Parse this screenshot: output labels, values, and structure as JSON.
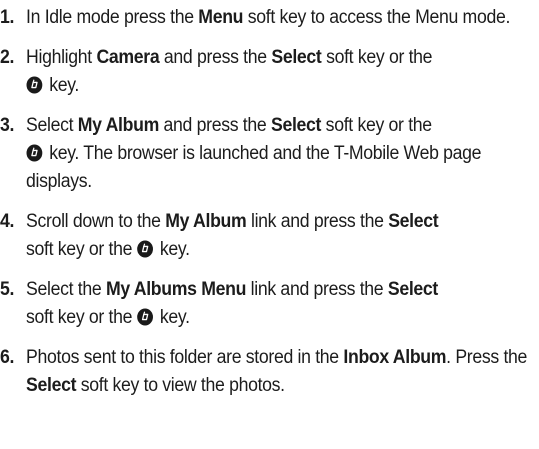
{
  "steps": [
    {
      "number": "1.",
      "t1": "In Idle mode press the ",
      "b1": "Menu",
      "t2": " soft key to access the Menu mode."
    },
    {
      "number": "2.",
      "t1": "Highlight ",
      "b1": "Camera",
      "t2": " and press the ",
      "b2": "Select",
      "t3": " soft key or the ",
      "icon": "nav-key-icon",
      "t4": " key."
    },
    {
      "number": "3.",
      "t1": "Select ",
      "b1": "My Album",
      "t2": " and press the ",
      "b2": "Select",
      "t3": " soft key or the ",
      "icon": "nav-key-icon",
      "t4": " key. The browser is launched and the T-Mobile Web page displays."
    },
    {
      "number": "4.",
      "t1": "Scroll down to the ",
      "b1": "My Album",
      "t2": " link and press the ",
      "b2": "Select",
      "t3": " soft key or the ",
      "icon": "nav-key-icon",
      "t4": " key."
    },
    {
      "number": "5.",
      "t1": "Select the ",
      "b1": "My Albums Menu",
      "t2": " link and press the ",
      "b2": "Select",
      "t3": " soft key or the ",
      "icon": "nav-key-icon",
      "t4": " key."
    },
    {
      "number": "6.",
      "t1": "Photos sent to this folder are stored in the ",
      "b1": "Inbox Album",
      "t2": ". Press the ",
      "b2": "Select",
      "t3": " soft key to view the photos."
    }
  ]
}
